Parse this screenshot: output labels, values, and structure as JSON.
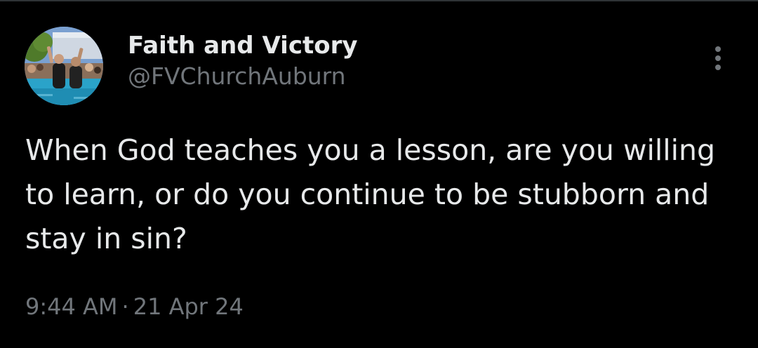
{
  "author": {
    "display_name": "Faith and Victory",
    "handle": "@FVChurchAuburn",
    "avatar_icon": "baptism-photo-avatar"
  },
  "tweet": {
    "text": "When God teaches you a lesson, are you willing to learn, or do you continue to be stubborn and stay in sin?",
    "time": "9:44 AM",
    "separator": "·",
    "date": "21 Apr 24"
  },
  "menu": {
    "icon": "more-vertical-icon"
  },
  "colors": {
    "background": "#000000",
    "primary_text": "#e7e9ea",
    "secondary_text": "#71767b"
  }
}
